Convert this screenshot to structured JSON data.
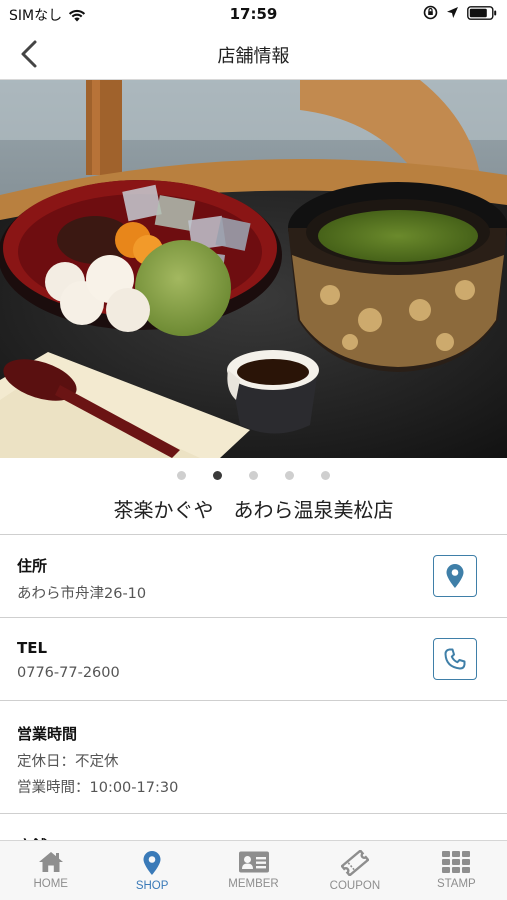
{
  "status_bar": {
    "carrier": "SIMなし",
    "time": "17:59"
  },
  "nav": {
    "title": "店舗情報"
  },
  "carousel": {
    "page_count": 5,
    "active_page": 2
  },
  "shop": {
    "name": "茶楽かぐや　あわら温泉美松店"
  },
  "address": {
    "label": "住所",
    "value": "あわら市舟津26-10"
  },
  "tel": {
    "label": "TEL",
    "value": "0776-77-2600"
  },
  "hours": {
    "label": "営業時間",
    "holiday": "定休日：不定休",
    "hours": "営業時間：10:00-17:30"
  },
  "url": {
    "label": "店舗URL"
  },
  "tabs": [
    {
      "label": "HOME",
      "icon": "home-icon",
      "active": false
    },
    {
      "label": "SHOP",
      "icon": "map-pin-icon",
      "active": true
    },
    {
      "label": "MEMBER",
      "icon": "member-card-icon",
      "active": false
    },
    {
      "label": "COUPON",
      "icon": "coupon-ticket-icon",
      "active": false
    },
    {
      "label": "STAMP",
      "icon": "stamp-grid-icon",
      "active": false
    }
  ],
  "colors": {
    "accent": "#3a7ab8",
    "button_border": "#3f7fa8",
    "inactive_tab": "#8e8e8e"
  }
}
